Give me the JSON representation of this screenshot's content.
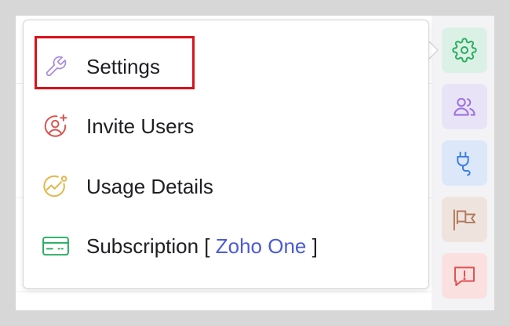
{
  "menu": {
    "items": [
      {
        "key": "settings",
        "label": "Settings",
        "icon": "wrench-icon",
        "icon_color": "#a88be0"
      },
      {
        "key": "invite",
        "label": "Invite Users",
        "icon": "add-user-icon",
        "icon_color": "#d9534f"
      },
      {
        "key": "usage",
        "label": "Usage Details",
        "icon": "usage-chart-icon",
        "icon_color": "#e3b64c"
      },
      {
        "key": "subscription",
        "label": "Subscription [ ",
        "plan_name": "Zoho One",
        "suffix": " ]",
        "icon": "credit-card-icon",
        "icon_color": "#27ae60"
      }
    ],
    "highlighted": "settings"
  },
  "rail": {
    "buttons": [
      {
        "key": "settings",
        "icon": "gear-icon",
        "color": "#27ae60"
      },
      {
        "key": "users",
        "icon": "users-icon",
        "color": "#9b6fe0"
      },
      {
        "key": "integrations",
        "icon": "plug-icon",
        "color": "#3a7fe0"
      },
      {
        "key": "flag",
        "icon": "flag-icon",
        "color": "#b07a5c"
      },
      {
        "key": "feedback",
        "icon": "feedback-icon",
        "color": "#e25252"
      }
    ]
  },
  "colors": {
    "plan_link": "#4b5bd6",
    "highlight": "#d8121b"
  }
}
